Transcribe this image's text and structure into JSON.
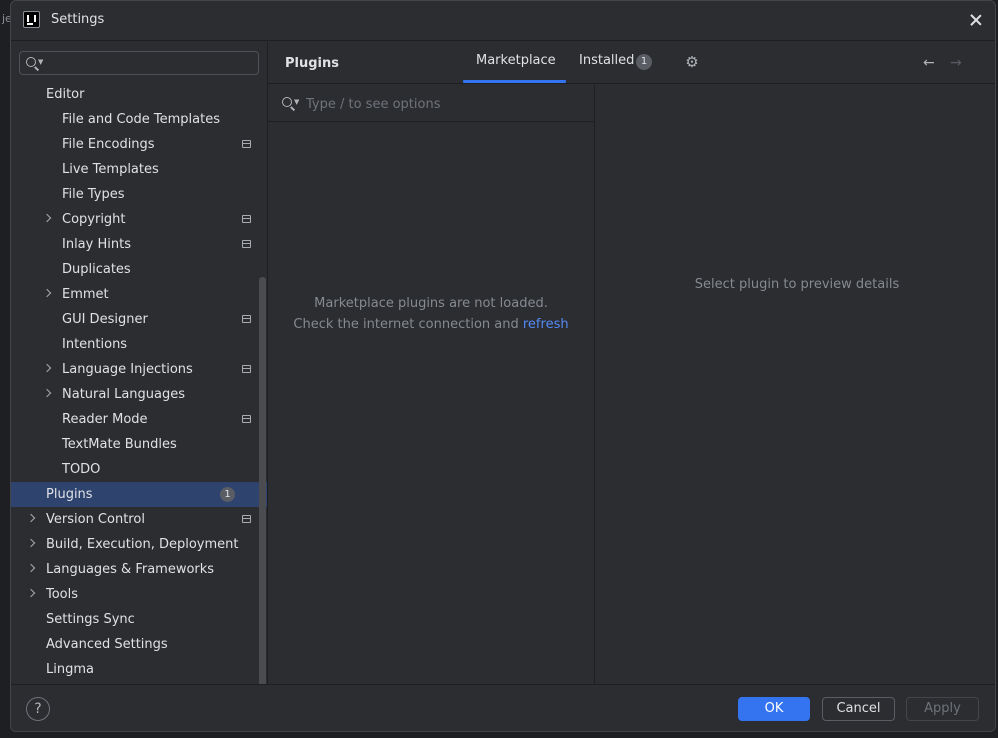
{
  "window": {
    "title": "Settings"
  },
  "background": {
    "left_text": "je"
  },
  "search": {
    "placeholder": ""
  },
  "tree": [
    {
      "label": "Editor",
      "level": 0,
      "chevron": false,
      "project": false
    },
    {
      "label": "File and Code Templates",
      "level": 1,
      "chevron": false,
      "project": false
    },
    {
      "label": "File Encodings",
      "level": 1,
      "chevron": false,
      "project": true
    },
    {
      "label": "Live Templates",
      "level": 1,
      "chevron": false,
      "project": false
    },
    {
      "label": "File Types",
      "level": 1,
      "chevron": false,
      "project": false
    },
    {
      "label": "Copyright",
      "level": 1,
      "chevron": true,
      "project": true
    },
    {
      "label": "Inlay Hints",
      "level": 1,
      "chevron": false,
      "project": true
    },
    {
      "label": "Duplicates",
      "level": 1,
      "chevron": false,
      "project": false
    },
    {
      "label": "Emmet",
      "level": 1,
      "chevron": true,
      "project": false
    },
    {
      "label": "GUI Designer",
      "level": 1,
      "chevron": false,
      "project": true
    },
    {
      "label": "Intentions",
      "level": 1,
      "chevron": false,
      "project": false
    },
    {
      "label": "Language Injections",
      "level": 1,
      "chevron": true,
      "project": true
    },
    {
      "label": "Natural Languages",
      "level": 1,
      "chevron": true,
      "project": false
    },
    {
      "label": "Reader Mode",
      "level": 1,
      "chevron": false,
      "project": true
    },
    {
      "label": "TextMate Bundles",
      "level": 1,
      "chevron": false,
      "project": false
    },
    {
      "label": "TODO",
      "level": 1,
      "chevron": false,
      "project": false
    },
    {
      "label": "Plugins",
      "level": 0,
      "chevron": false,
      "project": false,
      "selected": true,
      "badge": "1"
    },
    {
      "label": "Version Control",
      "level": 0,
      "chevron": true,
      "project": true
    },
    {
      "label": "Build, Execution, Deployment",
      "level": 0,
      "chevron": true,
      "project": false
    },
    {
      "label": "Languages & Frameworks",
      "level": 0,
      "chevron": true,
      "project": false
    },
    {
      "label": "Tools",
      "level": 0,
      "chevron": true,
      "project": false
    },
    {
      "label": "Settings Sync",
      "level": 0,
      "chevron": false,
      "project": false
    },
    {
      "label": "Advanced Settings",
      "level": 0,
      "chevron": false,
      "project": false
    },
    {
      "label": "Lingma",
      "level": 0,
      "chevron": false,
      "project": false
    }
  ],
  "plugins": {
    "title": "Plugins",
    "tabs": {
      "marketplace": "Marketplace",
      "installed": "Installed",
      "installed_badge": "1"
    },
    "search_placeholder": "Type / to see options",
    "empty_line1": "Marketplace plugins are not loaded.",
    "empty_line2": "Check the internet connection and ",
    "refresh_link": "refresh",
    "detail_message": "Select plugin to preview details",
    "icons": {
      "settings": "gear-icon",
      "back": "arrow-left-icon",
      "forward": "arrow-right-icon"
    }
  },
  "footer": {
    "help": "?",
    "ok": "OK",
    "cancel": "Cancel",
    "apply": "Apply"
  },
  "colors": {
    "accent": "#3574f0",
    "selection": "#2e436e",
    "link": "#548af7",
    "panel": "#2b2d30"
  }
}
